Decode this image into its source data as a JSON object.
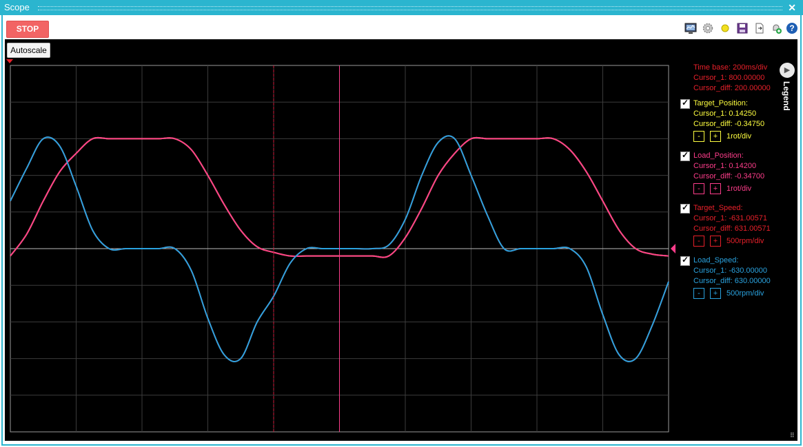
{
  "window": {
    "title": "Scope",
    "close_glyph": "✕"
  },
  "toolbar": {
    "stop_label": "STOP",
    "icons": [
      "monitor-icon",
      "settings-gear-icon",
      "status-dot-icon",
      "save-icon",
      "export-icon",
      "add-trigger-icon",
      "help-icon"
    ]
  },
  "autoscale_label": "Autoscale",
  "legend": {
    "header_lines": [
      "Time base: 200ms/div",
      "Cursor_1: 800.00000",
      "Cursor_diff: 200.00000"
    ],
    "button_label": "Legend",
    "signals": [
      {
        "name": "Target_Position:",
        "cursor1": "Cursor_1: 0.14250",
        "cursordiff": "Cursor_diff: -0.34750",
        "minus": "-",
        "plus": "+",
        "scale": "1rot/div",
        "color": "#ffff40",
        "name_color": "#ffff40",
        "checked": true
      },
      {
        "name": "Load_Position:",
        "cursor1": "Cursor_1: 0.14200",
        "cursordiff": "Cursor_diff: -0.34700",
        "minus": "-",
        "plus": "+",
        "scale": "1rot/div",
        "color": "#ff3d8b",
        "name_color": "#ff3d8b",
        "checked": true
      },
      {
        "name": "Target_Speed:",
        "cursor1": "Cursor_1: -631.00571",
        "cursordiff": "Cursor_diff: 631.00571",
        "minus": "-",
        "plus": "+",
        "scale": "500rpm/div",
        "color": "#e8202a",
        "name_color": "#e8202a",
        "checked": true
      },
      {
        "name": "Load_Speed:",
        "cursor1": "Cursor_1: -630.00000",
        "cursordiff": "Cursor_diff: 630.00000",
        "minus": "-",
        "plus": "+",
        "scale": "500rpm/div",
        "color": "#2aa3e0",
        "name_color": "#2aa3e0",
        "checked": true
      }
    ]
  },
  "chart_data": {
    "type": "line",
    "x_divisions": 10,
    "y_divisions": 10,
    "grid": true,
    "x_unit_per_div": "200ms",
    "cursors": {
      "cursor_1": 800,
      "cursor_diff": 200
    },
    "x": [
      0,
      50,
      100,
      150,
      200,
      250,
      300,
      350,
      400,
      450,
      500,
      550,
      600,
      650,
      700,
      750,
      800,
      850,
      900,
      950,
      1000,
      1050,
      1100,
      1150,
      1200,
      1250,
      1300,
      1350,
      1400,
      1450,
      1500,
      1550,
      1600,
      1650,
      1700,
      1750,
      1800,
      1850,
      1900,
      1950,
      2000
    ],
    "series": [
      {
        "name": "Target_Position",
        "color": "#ffff40",
        "values": [
          -0.2,
          0.4,
          1.3,
          2.1,
          2.6,
          3.0,
          3.0,
          3.0,
          3.0,
          3.0,
          3.0,
          2.7,
          2.0,
          1.2,
          0.5,
          0.05,
          -0.1,
          -0.2,
          -0.2,
          -0.2,
          -0.2,
          -0.2,
          -0.2,
          -0.2,
          0.3,
          1.1,
          2.0,
          2.6,
          3.0,
          3.0,
          3.0,
          3.0,
          3.0,
          3.0,
          2.7,
          2.1,
          1.3,
          0.5,
          0.0,
          -0.15,
          -0.2
        ]
      },
      {
        "name": "Load_Position",
        "color": "#ff3d8b",
        "values": [
          -0.2,
          0.4,
          1.3,
          2.1,
          2.6,
          3.0,
          3.0,
          3.0,
          3.0,
          3.0,
          3.0,
          2.7,
          2.0,
          1.2,
          0.5,
          0.05,
          -0.1,
          -0.2,
          -0.2,
          -0.2,
          -0.2,
          -0.2,
          -0.2,
          -0.2,
          0.3,
          1.1,
          2.0,
          2.6,
          3.0,
          3.0,
          3.0,
          3.0,
          3.0,
          3.0,
          2.7,
          2.1,
          1.3,
          0.5,
          0.0,
          -0.15,
          -0.2
        ]
      },
      {
        "name": "Target_Speed",
        "color": "#e8202a",
        "values": [
          1.3,
          2.2,
          3.0,
          2.8,
          1.7,
          0.5,
          0.0,
          0.0,
          0.0,
          0.0,
          0.0,
          -0.6,
          -1.9,
          -2.9,
          -3.0,
          -2.0,
          -1.3,
          -0.4,
          0.0,
          0.0,
          0.0,
          0.0,
          0.0,
          0.1,
          0.8,
          2.0,
          2.9,
          3.0,
          2.0,
          0.9,
          0.0,
          0.0,
          0.0,
          0.0,
          0.0,
          -0.5,
          -1.8,
          -2.9,
          -3.0,
          -2.1,
          -0.9
        ]
      },
      {
        "name": "Load_Speed",
        "color": "#2aa3e0",
        "values": [
          1.3,
          2.2,
          3.0,
          2.8,
          1.7,
          0.5,
          0.0,
          0.0,
          0.0,
          0.0,
          0.0,
          -0.6,
          -1.9,
          -2.9,
          -3.0,
          -2.0,
          -1.3,
          -0.4,
          0.0,
          0.0,
          0.0,
          0.0,
          0.0,
          0.1,
          0.8,
          2.0,
          2.9,
          3.0,
          2.0,
          0.9,
          0.0,
          0.0,
          0.0,
          0.0,
          0.0,
          -0.5,
          -1.8,
          -2.9,
          -3.0,
          -2.1,
          -0.9
        ]
      }
    ]
  }
}
